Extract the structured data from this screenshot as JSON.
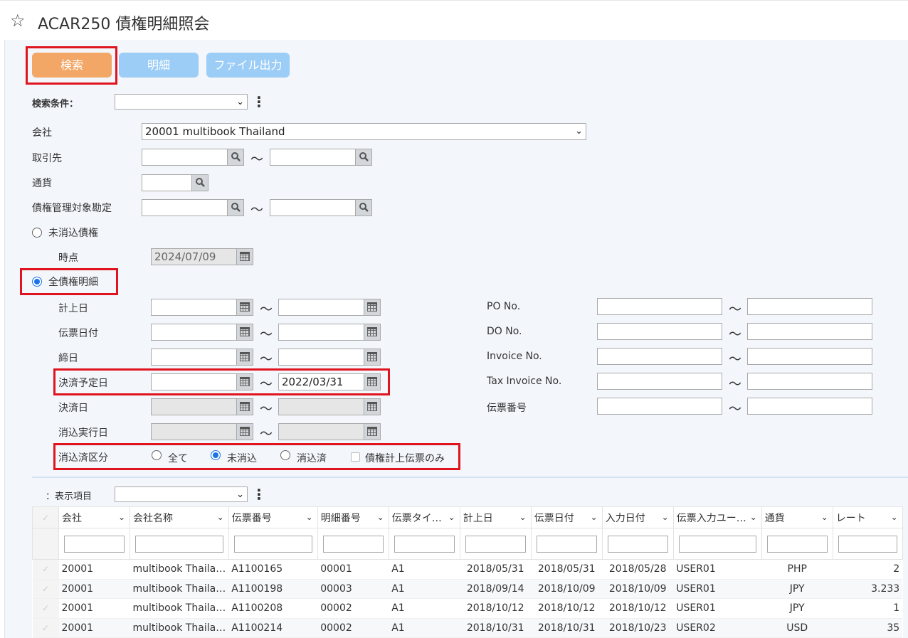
{
  "title": {
    "star_icon": "☆",
    "text": "ACAR250 債権明細照会"
  },
  "toolbar": {
    "search": "検索",
    "detail": "明細",
    "file_output": "ファイル出力"
  },
  "search_condition": {
    "label": "検索条件：",
    "value": ""
  },
  "fields": {
    "company": {
      "label": "会社",
      "value": "20001 multibook Thailand"
    },
    "partner": {
      "label": "取引先",
      "from": "",
      "to": ""
    },
    "currency": {
      "label": "通貨",
      "value": ""
    },
    "account": {
      "label": "債権管理対象勘定",
      "from": "",
      "to": ""
    },
    "unreconciled": {
      "label": "未消込債権",
      "selected": false
    },
    "as_of": {
      "label": "時点",
      "value": "2024/07/09"
    },
    "all_detail": {
      "label": "全債権明細",
      "selected": true
    },
    "posting_date": {
      "label": "計上日",
      "from": "",
      "to": ""
    },
    "voucher_date": {
      "label": "伝票日付",
      "from": "",
      "to": ""
    },
    "closing_date": {
      "label": "締日",
      "from": "",
      "to": ""
    },
    "settlement_plan_date": {
      "label": "決済予定日",
      "from": "",
      "to": "2022/03/31"
    },
    "settlement_date": {
      "label": "決済日",
      "from": "",
      "to": ""
    },
    "reconcile_exec_date": {
      "label": "消込実行日",
      "from": "",
      "to": ""
    },
    "reconcile_type": {
      "label": "消込済区分",
      "options": [
        "全て",
        "未消込",
        "消込済"
      ],
      "selected": "未消込",
      "checkbox_label": "債権計上伝票のみ"
    },
    "po_no": {
      "label": "PO No.",
      "from": "",
      "to": ""
    },
    "do_no": {
      "label": "DO No.",
      "from": "",
      "to": ""
    },
    "invoice_no": {
      "label": "Invoice No.",
      "from": "",
      "to": ""
    },
    "tax_invoice_no": {
      "label": "Tax Invoice No.",
      "from": "",
      "to": ""
    },
    "voucher_no": {
      "label": "伝票番号",
      "from": "",
      "to": ""
    }
  },
  "display_items": {
    "label": "：表示項目",
    "value": ""
  },
  "tilde": "〜",
  "grid": {
    "columns": [
      "会社",
      "会社名称",
      "伝票番号",
      "明細番号",
      "伝票タイ…",
      "計上日",
      "伝票日付",
      "入力日付",
      "伝票入力ユー…",
      "通貨",
      "レート"
    ],
    "rows": [
      [
        "20001",
        "multibook Thaila…",
        "A1100165",
        "00001",
        "A1",
        "2018/05/31",
        "2018/05/31",
        "2018/05/28",
        "USER01",
        "PHP",
        "2"
      ],
      [
        "20001",
        "multibook Thaila…",
        "A1100198",
        "00003",
        "A1",
        "2018/09/14",
        "2018/10/09",
        "2018/10/09",
        "USER01",
        "JPY",
        "3.233"
      ],
      [
        "20001",
        "multibook Thaila…",
        "A1100208",
        "00002",
        "A1",
        "2018/10/12",
        "2018/10/12",
        "2018/10/12",
        "USER01",
        "JPY",
        "1"
      ],
      [
        "20001",
        "multibook Thaila…",
        "A1100214",
        "00002",
        "A1",
        "2018/10/31",
        "2018/10/31",
        "2018/10/23",
        "USER02",
        "USD",
        "35"
      ]
    ]
  },
  "colors": {
    "search_button": "#f2a766",
    "secondary_button": "#9ccdf6",
    "highlight": "#e0141e",
    "radio_on": "#1a73e8"
  }
}
